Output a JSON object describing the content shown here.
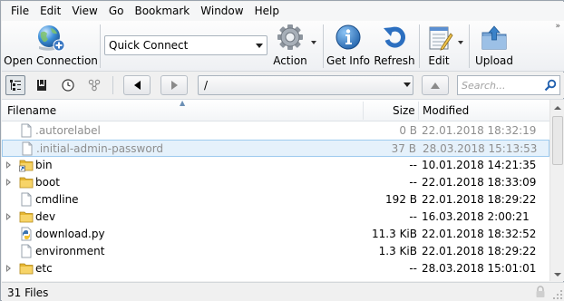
{
  "menu": [
    "File",
    "Edit",
    "View",
    "Go",
    "Bookmark",
    "Window",
    "Help"
  ],
  "toolbar": {
    "open_connection": "Open Connection",
    "quick_connect": "Quick Connect",
    "action": "Action",
    "get_info": "Get Info",
    "refresh": "Refresh",
    "edit": "Edit",
    "upload": "Upload",
    "overflow": "»"
  },
  "navigation": {
    "path": "/",
    "search_placeholder": "Search..."
  },
  "browser": {
    "columns": {
      "filename": "Filename",
      "size": "Size",
      "modified": "Modified"
    },
    "rows": [
      {
        "name": ".autorelabel",
        "size": "0 B",
        "modified": "22.01.2018 18:32:19",
        "type": "file",
        "hidden": true,
        "selected": false
      },
      {
        "name": ".initial-admin-password",
        "size": "37 B",
        "modified": "28.03.2018 15:13:53",
        "type": "file",
        "hidden": true,
        "selected": true
      },
      {
        "name": "bin",
        "size": "--",
        "modified": "10.01.2018 14:21:35",
        "type": "folder-link",
        "hidden": false,
        "selected": false
      },
      {
        "name": "boot",
        "size": "--",
        "modified": "22.01.2018 18:33:09",
        "type": "folder",
        "hidden": false,
        "selected": false
      },
      {
        "name": "cmdline",
        "size": "192 B",
        "modified": "22.01.2018 18:29:22",
        "type": "file",
        "hidden": false,
        "selected": false
      },
      {
        "name": "dev",
        "size": "--",
        "modified": "16.03.2018 2:00:21",
        "type": "folder",
        "hidden": false,
        "selected": false
      },
      {
        "name": "download.py",
        "size": "11.3 KiB",
        "modified": "22.01.2018 18:32:52",
        "type": "python",
        "hidden": false,
        "selected": false
      },
      {
        "name": "environment",
        "size": "1.3 KiB",
        "modified": "22.01.2018 18:29:22",
        "type": "file",
        "hidden": false,
        "selected": false
      },
      {
        "name": "etc",
        "size": "--",
        "modified": "28.03.2018 15:01:01",
        "type": "folder",
        "hidden": false,
        "selected": false
      }
    ]
  },
  "status": {
    "text": "31 Files"
  },
  "colors": {
    "selection_bg": "#e5f1fb",
    "selection_border": "#9ecaee",
    "hidden_text": "#8e8e8e",
    "folder_yellow": "#f2c84b"
  }
}
